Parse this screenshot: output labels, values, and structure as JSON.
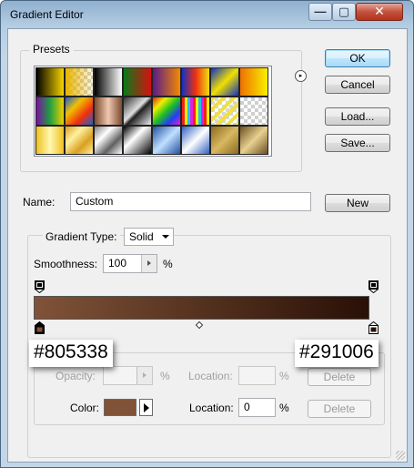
{
  "window": {
    "title": "Gradient Editor",
    "minimize_glyph": "—",
    "maximize_glyph": "▢",
    "close_glyph": "✕"
  },
  "presets": {
    "legend": "Presets",
    "menu_icon": "▸",
    "swatches": [
      "linear-gradient(90deg,#000,#f7d400)",
      "linear-gradient(90deg,#e8b300,rgba(255,200,0,0.1)),repeating-conic-gradient(#ccc 0 25%,#fff 0 50%) 0 0/8px 8px",
      "linear-gradient(90deg,#000,#fff)",
      "linear-gradient(90deg,#0a7a1a,#d81010)",
      "linear-gradient(90deg,#5a1a8a,#f28a00)",
      "linear-gradient(90deg,#1530c0,#f03010,#f0e010)",
      "linear-gradient(135deg,#1030c0,#f0e000,#1030c0)",
      "linear-gradient(90deg,#f07000,#f8f000)",
      "linear-gradient(90deg,#7a10a0,#20a040,#f0d000)",
      "linear-gradient(135deg,#1a60d0,#f0c000,#f03010,#1a60d0)",
      "linear-gradient(90deg,#7a4a30,#f0c8b0,#7a4a30)",
      "linear-gradient(135deg,#303030,#e0e0e0 45%,#202020 55%,#f0f0f0)",
      "linear-gradient(135deg,#e02020,#f0f000,#20c020,#2040f0,#e020e0)",
      "repeating-linear-gradient(90deg,#f02020 0 3px,#f0f000 3px 6px,#20c0f0 6px 9px,#e020e0 9px 12px)",
      "repeating-linear-gradient(135deg,#f0e040 0 4px,rgba(255,255,255,0.2) 4px 8px),repeating-conic-gradient(#ccc 0 25%,#fff 0 50%) 0 0/8px 8px",
      "repeating-conic-gradient(#cfcfcf 0 25%,#fff 0 50%) 0 0/8px 8px",
      "linear-gradient(90deg,#f0c020,#fff8b0,#f0c020)",
      "linear-gradient(135deg,#d8a020,#fff0a0,#d8a020,#fff0a0)",
      "linear-gradient(135deg,#808080,#ffffff,#606060,#ffffff)",
      "linear-gradient(135deg,#000,#fff 40%,#000)",
      "linear-gradient(135deg,#2050a0,#c0e0ff,#2050a0)",
      "linear-gradient(135deg,#3060c0,#ffffff,#3060c0)",
      "linear-gradient(135deg,#8a6a20,#d8b860,#8a6a20)",
      "linear-gradient(135deg,#6a5020,#e8d090,#6a5020)"
    ]
  },
  "buttons": {
    "ok": "OK",
    "cancel": "Cancel",
    "load": "Load...",
    "save": "Save...",
    "new": "New"
  },
  "name_field": {
    "label": "Name:",
    "value": "Custom"
  },
  "gradient": {
    "type_label": "Gradient Type:",
    "type_value": "Solid",
    "smoothness_label": "Smoothness:",
    "smoothness_value": "100",
    "smoothness_unit": "%",
    "start_color": "#805338",
    "end_color": "#291006",
    "start_hex_label": "#805338",
    "end_hex_label": "#291006"
  },
  "stops": {
    "opacity_label": "Opacity:",
    "opacity_value": "",
    "opacity_unit": "%",
    "opacity_location_label": "Location:",
    "opacity_location_value": "",
    "opacity_location_unit": "%",
    "opacity_delete": "Delete",
    "color_label": "Color:",
    "color_value": "#805338",
    "color_location_label": "Location:",
    "color_location_value": "0",
    "color_location_unit": "%",
    "color_delete": "Delete"
  }
}
